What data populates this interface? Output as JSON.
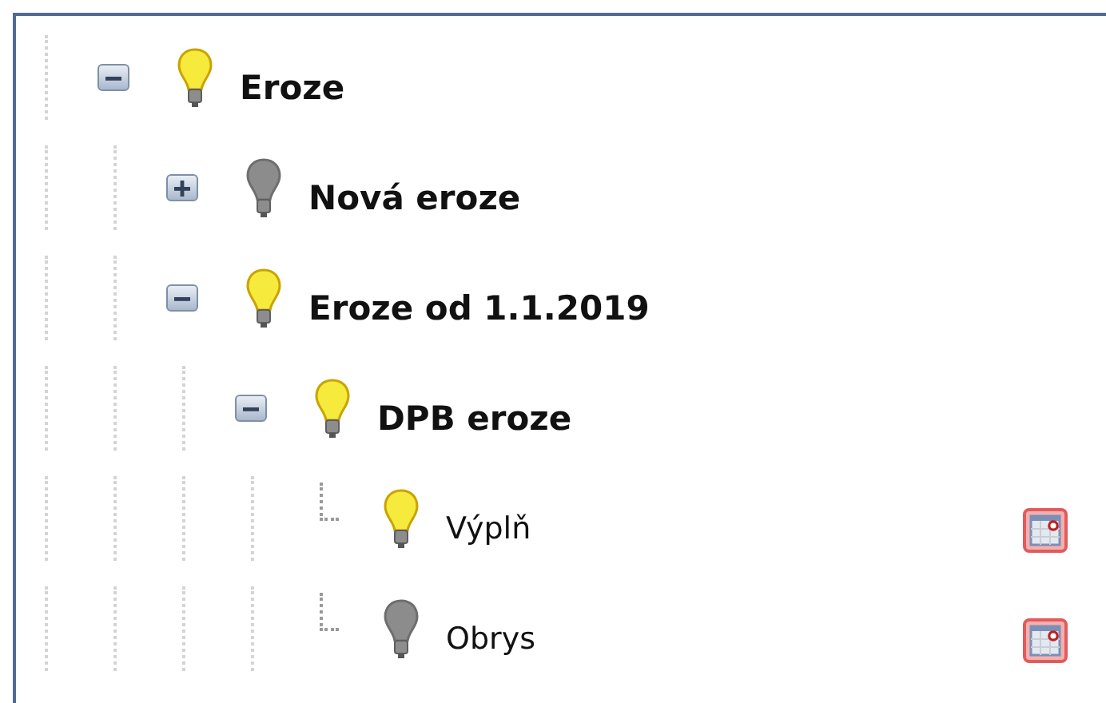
{
  "tree": [
    {
      "kind": "group",
      "label": "Eroze",
      "expanded": true,
      "visible": true,
      "children": [
        {
          "kind": "group",
          "label": "Nová eroze",
          "expanded": false,
          "visible": false
        },
        {
          "kind": "group",
          "label": "Eroze od 1.1.2019",
          "expanded": true,
          "visible": true,
          "children": [
            {
              "kind": "group",
              "label": "DPB eroze",
              "expanded": true,
              "visible": true,
              "children": [
                {
                  "kind": "layer",
                  "label": "Výplň",
                  "visible": true
                },
                {
                  "kind": "layer",
                  "label": "Obrys",
                  "visible": false
                }
              ]
            }
          ]
        }
      ]
    }
  ]
}
